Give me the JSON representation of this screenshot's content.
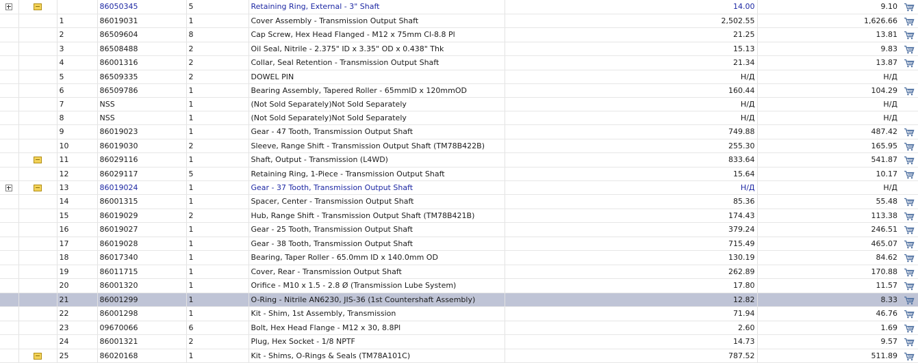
{
  "colors": {
    "link": "#1c27a3",
    "selected_row": "#bfc4d6",
    "note_icon": "#f3d35a",
    "cart_icon": "#4d6fa0"
  },
  "rows": [
    {
      "pos": "",
      "num": "86050345",
      "qty": "5",
      "desc": "Retaining Ring, External - 3\" Shaft",
      "price1": "14.00",
      "price2": "9.10",
      "expand": true,
      "note": true,
      "link": true,
      "selected": false
    },
    {
      "pos": "1",
      "num": "86019031",
      "qty": "1",
      "desc": "Cover Assembly - Transmission Output Shaft",
      "price1": "2,502.55",
      "price2": "1,626.66",
      "expand": false,
      "note": false,
      "link": false,
      "selected": false
    },
    {
      "pos": "2",
      "num": "86509604",
      "qty": "8",
      "desc": "Cap Screw, Hex Head Flanged - M12 x 75mm Cl-8.8 Pl",
      "price1": "21.25",
      "price2": "13.81",
      "expand": false,
      "note": false,
      "link": false,
      "selected": false
    },
    {
      "pos": "3",
      "num": "86508488",
      "qty": "2",
      "desc": "Oil Seal, Nitrile - 2.375\" ID x 3.35\" OD x 0.438\" Thk",
      "price1": "15.13",
      "price2": "9.83",
      "expand": false,
      "note": false,
      "link": false,
      "selected": false
    },
    {
      "pos": "4",
      "num": "86001316",
      "qty": "2",
      "desc": "Collar, Seal Retention - Transmission Output Shaft",
      "price1": "21.34",
      "price2": "13.87",
      "expand": false,
      "note": false,
      "link": false,
      "selected": false
    },
    {
      "pos": "5",
      "num": "86509335",
      "qty": "2",
      "desc": "DOWEL PIN",
      "price1": "Н/Д",
      "price2": "Н/Д",
      "expand": false,
      "note": false,
      "link": false,
      "selected": false
    },
    {
      "pos": "6",
      "num": "86509786",
      "qty": "1",
      "desc": "Bearing Assembly, Tapered Roller - 65mmID x 120mmOD",
      "price1": "160.44",
      "price2": "104.29",
      "expand": false,
      "note": false,
      "link": false,
      "selected": false
    },
    {
      "pos": "7",
      "num": "NSS",
      "qty": "1",
      "desc": "(Not Sold Separately)Not Sold Separately",
      "price1": "Н/Д",
      "price2": "Н/Д",
      "expand": false,
      "note": false,
      "link": false,
      "selected": false
    },
    {
      "pos": "8",
      "num": "NSS",
      "qty": "1",
      "desc": "(Not Sold Separately)Not Sold Separately",
      "price1": "Н/Д",
      "price2": "Н/Д",
      "expand": false,
      "note": false,
      "link": false,
      "selected": false
    },
    {
      "pos": "9",
      "num": "86019023",
      "qty": "1",
      "desc": "Gear - 47 Tooth, Transmission Output Shaft",
      "price1": "749.88",
      "price2": "487.42",
      "expand": false,
      "note": false,
      "link": false,
      "selected": false
    },
    {
      "pos": "10",
      "num": "86019030",
      "qty": "2",
      "desc": "Sleeve, Range Shift - Transmission Output Shaft (TM78B422B)",
      "price1": "255.30",
      "price2": "165.95",
      "expand": false,
      "note": false,
      "link": false,
      "selected": false
    },
    {
      "pos": "11",
      "num": "86029116",
      "qty": "1",
      "desc": "Shaft, Output - Transmission (L4WD)",
      "price1": "833.64",
      "price2": "541.87",
      "expand": false,
      "note": true,
      "link": false,
      "selected": false
    },
    {
      "pos": "12",
      "num": "86029117",
      "qty": "5",
      "desc": "Retaining Ring, 1-Piece - Transmission Output Shaft",
      "price1": "15.64",
      "price2": "10.17",
      "expand": false,
      "note": false,
      "link": false,
      "selected": false
    },
    {
      "pos": "13",
      "num": "86019024",
      "qty": "1",
      "desc": "Gear - 37 Tooth, Transmission Output Shaft",
      "price1": "Н/Д",
      "price2": "Н/Д",
      "expand": true,
      "note": true,
      "link": true,
      "selected": false
    },
    {
      "pos": "14",
      "num": "86001315",
      "qty": "1",
      "desc": "Spacer, Center - Transmission Output Shaft",
      "price1": "85.36",
      "price2": "55.48",
      "expand": false,
      "note": false,
      "link": false,
      "selected": false
    },
    {
      "pos": "15",
      "num": "86019029",
      "qty": "2",
      "desc": "Hub, Range Shift - Transmission Output Shaft (TM78B421B)",
      "price1": "174.43",
      "price2": "113.38",
      "expand": false,
      "note": false,
      "link": false,
      "selected": false
    },
    {
      "pos": "16",
      "num": "86019027",
      "qty": "1",
      "desc": "Gear - 25 Tooth, Transmission Output Shaft",
      "price1": "379.24",
      "price2": "246.51",
      "expand": false,
      "note": false,
      "link": false,
      "selected": false
    },
    {
      "pos": "17",
      "num": "86019028",
      "qty": "1",
      "desc": "Gear - 38 Tooth, Transmission Output Shaft",
      "price1": "715.49",
      "price2": "465.07",
      "expand": false,
      "note": false,
      "link": false,
      "selected": false
    },
    {
      "pos": "18",
      "num": "86017340",
      "qty": "1",
      "desc": "Bearing, Taper Roller - 65.0mm ID x 140.0mm OD",
      "price1": "130.19",
      "price2": "84.62",
      "expand": false,
      "note": false,
      "link": false,
      "selected": false
    },
    {
      "pos": "19",
      "num": "86011715",
      "qty": "1",
      "desc": "Cover, Rear - Transmission Output Shaft",
      "price1": "262.89",
      "price2": "170.88",
      "expand": false,
      "note": false,
      "link": false,
      "selected": false
    },
    {
      "pos": "20",
      "num": "86001320",
      "qty": "1",
      "desc": "Orifice - M10 x 1.5 - 2.8 Ø (Transmission Lube System)",
      "price1": "17.80",
      "price2": "11.57",
      "expand": false,
      "note": false,
      "link": false,
      "selected": false
    },
    {
      "pos": "21",
      "num": "86001299",
      "qty": "1",
      "desc": "O-Ring - Nitrile AN6230, JIS-36 (1st Countershaft Assembly)",
      "price1": "12.82",
      "price2": "8.33",
      "expand": false,
      "note": false,
      "link": false,
      "selected": true
    },
    {
      "pos": "22",
      "num": "86001298",
      "qty": "1",
      "desc": "Kit - Shim, 1st Assembly, Transmission",
      "price1": "71.94",
      "price2": "46.76",
      "expand": false,
      "note": false,
      "link": false,
      "selected": false
    },
    {
      "pos": "23",
      "num": "09670066",
      "qty": "6",
      "desc": "Bolt, Hex Head Flange - M12 x 30, 8.8Pl",
      "price1": "2.60",
      "price2": "1.69",
      "expand": false,
      "note": false,
      "link": false,
      "selected": false
    },
    {
      "pos": "24",
      "num": "86001321",
      "qty": "2",
      "desc": "Plug, Hex Socket - 1/8 NPTF",
      "price1": "14.73",
      "price2": "9.57",
      "expand": false,
      "note": false,
      "link": false,
      "selected": false
    },
    {
      "pos": "25",
      "num": "86020168",
      "qty": "1",
      "desc": "Kit - Shims, O-Rings & Seals (TM78A101C)",
      "price1": "787.52",
      "price2": "511.89",
      "expand": false,
      "note": true,
      "link": false,
      "selected": false
    }
  ]
}
